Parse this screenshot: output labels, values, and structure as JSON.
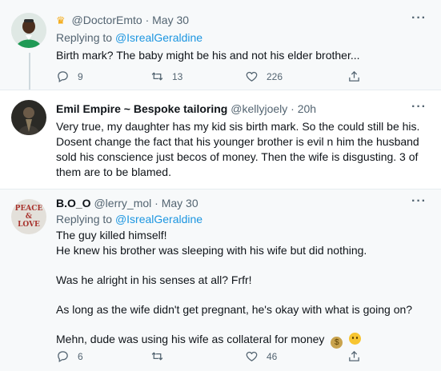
{
  "tweets": [
    {
      "name": "",
      "handle": "@DoctorEmto",
      "time": "May 30",
      "crown_icon": "crown-icon",
      "replying_prefix": "Replying to",
      "replying_to": "@IsrealGeraldine",
      "text": [
        "Birth mark? The baby might be his and not his elder brother..."
      ],
      "counts": {
        "reply": "9",
        "retweet": "13",
        "like": "226"
      }
    },
    {
      "name": "Emil Empire ~ Bespoke tailoring",
      "handle": "@kellyjoely",
      "time": "20h",
      "text": [
        "Very true, my daughter has my kid sis birth mark. So the could still be his. Dosent change the fact that his younger brother is evil n him the husband sold his conscience just becos of money. Then the wife is disgusting. 3 of them are to be blamed."
      ]
    },
    {
      "name": "B.O_O",
      "handle": "@lerry_mol",
      "time": "May 30",
      "replying_prefix": "Replying to",
      "replying_to": "@IsrealGeraldine",
      "avatar_text": [
        "PEACE",
        "&",
        "LOVE"
      ],
      "text": [
        "The guy killed himself!",
        "He knew his brother was sleeping with his wife but did nothing.",
        "Was he alright in his senses at all? Frfr!",
        "As long as the wife didn't get pregnant, he's okay with what is going on?",
        "Mehn, dude was using his wife as collateral for money"
      ],
      "emojis": [
        "money-bag-icon",
        "worried-face-icon"
      ],
      "counts": {
        "reply": "6",
        "retweet": "",
        "like": "46"
      }
    }
  ],
  "dot": "·",
  "more_label": "···",
  "colors": {
    "link": "#1b95e0",
    "muted": "#536471",
    "background_alt": "#f7f9fa"
  }
}
